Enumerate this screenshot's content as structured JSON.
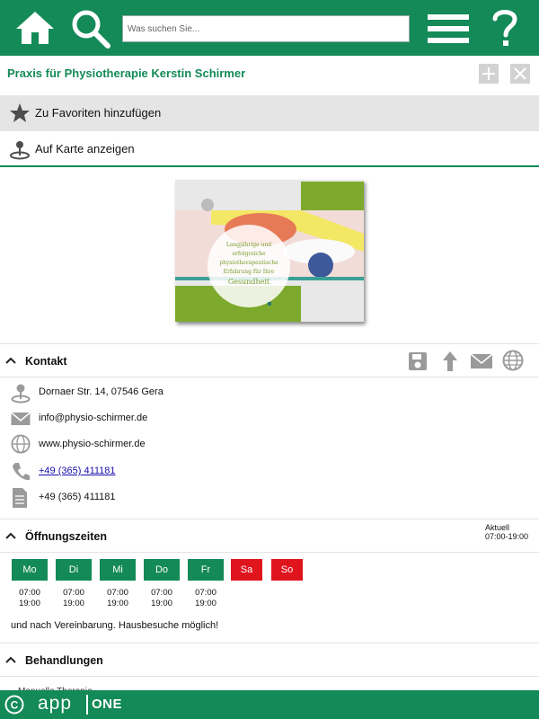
{
  "header": {
    "home_icon": "home-icon",
    "search_icon": "search-icon",
    "menu_icon": "hamburger-menu-icon",
    "help_icon": "help-icon",
    "search": {
      "placeholder": "Was suchen Sie...",
      "value": ""
    }
  },
  "page": {
    "title": "Praxis für Physiotherapie Kerstin Schirmer"
  },
  "actions": {
    "favorite_label": "Zu Favoriten hinzufügen",
    "map_label": "Auf Karte anzeigen"
  },
  "banner": {
    "text_lines": [
      "Langjährige und",
      "erfolgreiche",
      "physiotherapeutische",
      "Erfahrung für Ihre",
      "Gesundheit"
    ]
  },
  "contact": {
    "title": "Kontakt",
    "address": "Dornaer Str. 14, 07546 Gera",
    "email": "info@physio-schirmer.de",
    "website": "www.physio-schirmer.de",
    "phone": "+49 (365) 411181",
    "fax": "+49 (365) 411181"
  },
  "hours": {
    "title": "Öffnungszeiten",
    "current_label": "Aktuell",
    "current_value": "07:00-19:00",
    "days": [
      {
        "label": "Mo",
        "open": "07:00",
        "close": "19:00"
      },
      {
        "label": "Di",
        "open": "07:00",
        "close": "19:00"
      },
      {
        "label": "Mi",
        "open": "07:00",
        "close": "19:00"
      },
      {
        "label": "Do",
        "open": "07:00",
        "close": "19:00"
      },
      {
        "label": "Fr",
        "open": "07:00",
        "close": "19:00"
      },
      {
        "label": "Sa",
        "open": "",
        "close": ""
      },
      {
        "label": "So",
        "open": "",
        "close": ""
      }
    ],
    "note": "und nach Vereinbarung. Hausbesuche möglich!"
  },
  "treatments": {
    "title": "Behandlungen",
    "first_item": "Manuelle Therapie"
  },
  "footer": {
    "copyright_symbol": "©",
    "brand_app": "app",
    "brand_one": "ONE"
  },
  "colors": {
    "primary": "#138a57",
    "closed_day": "#e0141d",
    "icon_gray": "#8a8a8a"
  }
}
